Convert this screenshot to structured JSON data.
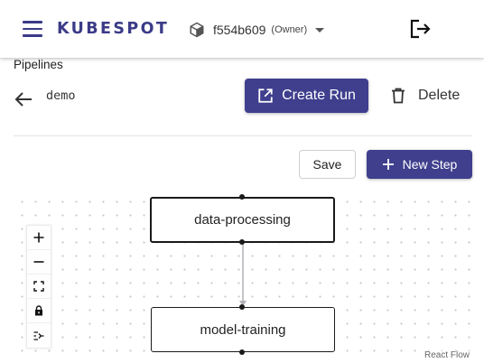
{
  "header": {
    "brand": "KUBESPOT",
    "org": {
      "name": "f554b609",
      "role": "(Owner)"
    }
  },
  "page": {
    "breadcrumb": "Pipelines",
    "pipeline_name": "demo",
    "create_run_label": "Create Run",
    "delete_label": "Delete"
  },
  "toolbar": {
    "save_label": "Save",
    "new_step_label": "New Step"
  },
  "flow": {
    "nodes": [
      "data-processing",
      "model-training"
    ],
    "attribution": "React Flow",
    "controls": [
      "zoom-in",
      "zoom-out",
      "fit-view",
      "lock",
      "layout"
    ]
  },
  "colors": {
    "brand": "#3b3b87",
    "primary_button": "#3f3f8e"
  }
}
